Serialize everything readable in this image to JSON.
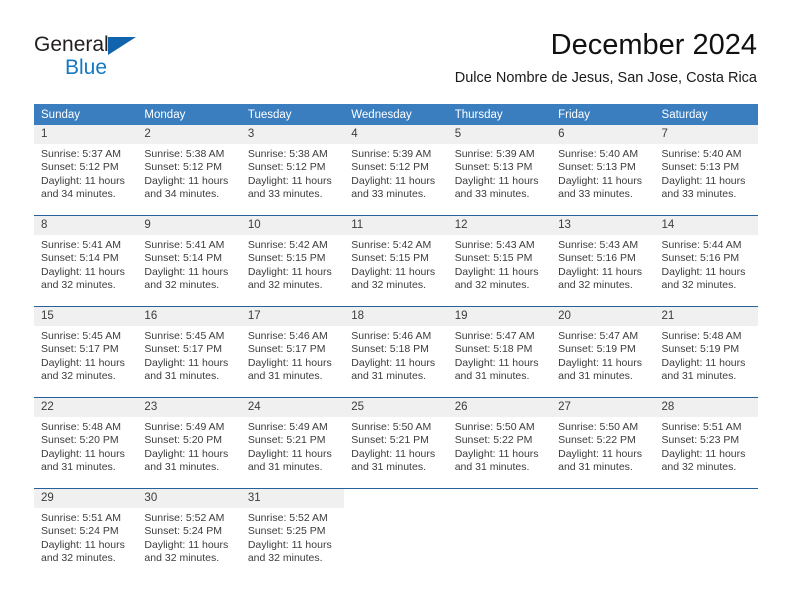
{
  "brand": {
    "name_part1": "General",
    "name_part2": "Blue",
    "triangle_color": "#1263ad",
    "blue_color": "#1379c4"
  },
  "header": {
    "title": "December 2024",
    "subtitle": "Dulce Nombre de Jesus, San Jose, Costa Rica"
  },
  "theme": {
    "header_row_bg": "#3a7ebf",
    "week_divider": "#2a6099",
    "daynum_bg": "#f0f0f0",
    "text_color": "#3c3c3c"
  },
  "weekdays": [
    "Sunday",
    "Monday",
    "Tuesday",
    "Wednesday",
    "Thursday",
    "Friday",
    "Saturday"
  ],
  "weeks": [
    [
      {
        "day": "1",
        "sunrise": "Sunrise: 5:37 AM",
        "sunset": "Sunset: 5:12 PM",
        "daylight1": "Daylight: 11 hours",
        "daylight2": "and 34 minutes."
      },
      {
        "day": "2",
        "sunrise": "Sunrise: 5:38 AM",
        "sunset": "Sunset: 5:12 PM",
        "daylight1": "Daylight: 11 hours",
        "daylight2": "and 34 minutes."
      },
      {
        "day": "3",
        "sunrise": "Sunrise: 5:38 AM",
        "sunset": "Sunset: 5:12 PM",
        "daylight1": "Daylight: 11 hours",
        "daylight2": "and 33 minutes."
      },
      {
        "day": "4",
        "sunrise": "Sunrise: 5:39 AM",
        "sunset": "Sunset: 5:12 PM",
        "daylight1": "Daylight: 11 hours",
        "daylight2": "and 33 minutes."
      },
      {
        "day": "5",
        "sunrise": "Sunrise: 5:39 AM",
        "sunset": "Sunset: 5:13 PM",
        "daylight1": "Daylight: 11 hours",
        "daylight2": "and 33 minutes."
      },
      {
        "day": "6",
        "sunrise": "Sunrise: 5:40 AM",
        "sunset": "Sunset: 5:13 PM",
        "daylight1": "Daylight: 11 hours",
        "daylight2": "and 33 minutes."
      },
      {
        "day": "7",
        "sunrise": "Sunrise: 5:40 AM",
        "sunset": "Sunset: 5:13 PM",
        "daylight1": "Daylight: 11 hours",
        "daylight2": "and 33 minutes."
      }
    ],
    [
      {
        "day": "8",
        "sunrise": "Sunrise: 5:41 AM",
        "sunset": "Sunset: 5:14 PM",
        "daylight1": "Daylight: 11 hours",
        "daylight2": "and 32 minutes."
      },
      {
        "day": "9",
        "sunrise": "Sunrise: 5:41 AM",
        "sunset": "Sunset: 5:14 PM",
        "daylight1": "Daylight: 11 hours",
        "daylight2": "and 32 minutes."
      },
      {
        "day": "10",
        "sunrise": "Sunrise: 5:42 AM",
        "sunset": "Sunset: 5:15 PM",
        "daylight1": "Daylight: 11 hours",
        "daylight2": "and 32 minutes."
      },
      {
        "day": "11",
        "sunrise": "Sunrise: 5:42 AM",
        "sunset": "Sunset: 5:15 PM",
        "daylight1": "Daylight: 11 hours",
        "daylight2": "and 32 minutes."
      },
      {
        "day": "12",
        "sunrise": "Sunrise: 5:43 AM",
        "sunset": "Sunset: 5:15 PM",
        "daylight1": "Daylight: 11 hours",
        "daylight2": "and 32 minutes."
      },
      {
        "day": "13",
        "sunrise": "Sunrise: 5:43 AM",
        "sunset": "Sunset: 5:16 PM",
        "daylight1": "Daylight: 11 hours",
        "daylight2": "and 32 minutes."
      },
      {
        "day": "14",
        "sunrise": "Sunrise: 5:44 AM",
        "sunset": "Sunset: 5:16 PM",
        "daylight1": "Daylight: 11 hours",
        "daylight2": "and 32 minutes."
      }
    ],
    [
      {
        "day": "15",
        "sunrise": "Sunrise: 5:45 AM",
        "sunset": "Sunset: 5:17 PM",
        "daylight1": "Daylight: 11 hours",
        "daylight2": "and 32 minutes."
      },
      {
        "day": "16",
        "sunrise": "Sunrise: 5:45 AM",
        "sunset": "Sunset: 5:17 PM",
        "daylight1": "Daylight: 11 hours",
        "daylight2": "and 31 minutes."
      },
      {
        "day": "17",
        "sunrise": "Sunrise: 5:46 AM",
        "sunset": "Sunset: 5:17 PM",
        "daylight1": "Daylight: 11 hours",
        "daylight2": "and 31 minutes."
      },
      {
        "day": "18",
        "sunrise": "Sunrise: 5:46 AM",
        "sunset": "Sunset: 5:18 PM",
        "daylight1": "Daylight: 11 hours",
        "daylight2": "and 31 minutes."
      },
      {
        "day": "19",
        "sunrise": "Sunrise: 5:47 AM",
        "sunset": "Sunset: 5:18 PM",
        "daylight1": "Daylight: 11 hours",
        "daylight2": "and 31 minutes."
      },
      {
        "day": "20",
        "sunrise": "Sunrise: 5:47 AM",
        "sunset": "Sunset: 5:19 PM",
        "daylight1": "Daylight: 11 hours",
        "daylight2": "and 31 minutes."
      },
      {
        "day": "21",
        "sunrise": "Sunrise: 5:48 AM",
        "sunset": "Sunset: 5:19 PM",
        "daylight1": "Daylight: 11 hours",
        "daylight2": "and 31 minutes."
      }
    ],
    [
      {
        "day": "22",
        "sunrise": "Sunrise: 5:48 AM",
        "sunset": "Sunset: 5:20 PM",
        "daylight1": "Daylight: 11 hours",
        "daylight2": "and 31 minutes."
      },
      {
        "day": "23",
        "sunrise": "Sunrise: 5:49 AM",
        "sunset": "Sunset: 5:20 PM",
        "daylight1": "Daylight: 11 hours",
        "daylight2": "and 31 minutes."
      },
      {
        "day": "24",
        "sunrise": "Sunrise: 5:49 AM",
        "sunset": "Sunset: 5:21 PM",
        "daylight1": "Daylight: 11 hours",
        "daylight2": "and 31 minutes."
      },
      {
        "day": "25",
        "sunrise": "Sunrise: 5:50 AM",
        "sunset": "Sunset: 5:21 PM",
        "daylight1": "Daylight: 11 hours",
        "daylight2": "and 31 minutes."
      },
      {
        "day": "26",
        "sunrise": "Sunrise: 5:50 AM",
        "sunset": "Sunset: 5:22 PM",
        "daylight1": "Daylight: 11 hours",
        "daylight2": "and 31 minutes."
      },
      {
        "day": "27",
        "sunrise": "Sunrise: 5:50 AM",
        "sunset": "Sunset: 5:22 PM",
        "daylight1": "Daylight: 11 hours",
        "daylight2": "and 31 minutes."
      },
      {
        "day": "28",
        "sunrise": "Sunrise: 5:51 AM",
        "sunset": "Sunset: 5:23 PM",
        "daylight1": "Daylight: 11 hours",
        "daylight2": "and 32 minutes."
      }
    ],
    [
      {
        "day": "29",
        "sunrise": "Sunrise: 5:51 AM",
        "sunset": "Sunset: 5:24 PM",
        "daylight1": "Daylight: 11 hours",
        "daylight2": "and 32 minutes."
      },
      {
        "day": "30",
        "sunrise": "Sunrise: 5:52 AM",
        "sunset": "Sunset: 5:24 PM",
        "daylight1": "Daylight: 11 hours",
        "daylight2": "and 32 minutes."
      },
      {
        "day": "31",
        "sunrise": "Sunrise: 5:52 AM",
        "sunset": "Sunset: 5:25 PM",
        "daylight1": "Daylight: 11 hours",
        "daylight2": "and 32 minutes."
      },
      {
        "day": "",
        "sunrise": "",
        "sunset": "",
        "daylight1": "",
        "daylight2": ""
      },
      {
        "day": "",
        "sunrise": "",
        "sunset": "",
        "daylight1": "",
        "daylight2": ""
      },
      {
        "day": "",
        "sunrise": "",
        "sunset": "",
        "daylight1": "",
        "daylight2": ""
      },
      {
        "day": "",
        "sunrise": "",
        "sunset": "",
        "daylight1": "",
        "daylight2": ""
      }
    ]
  ]
}
